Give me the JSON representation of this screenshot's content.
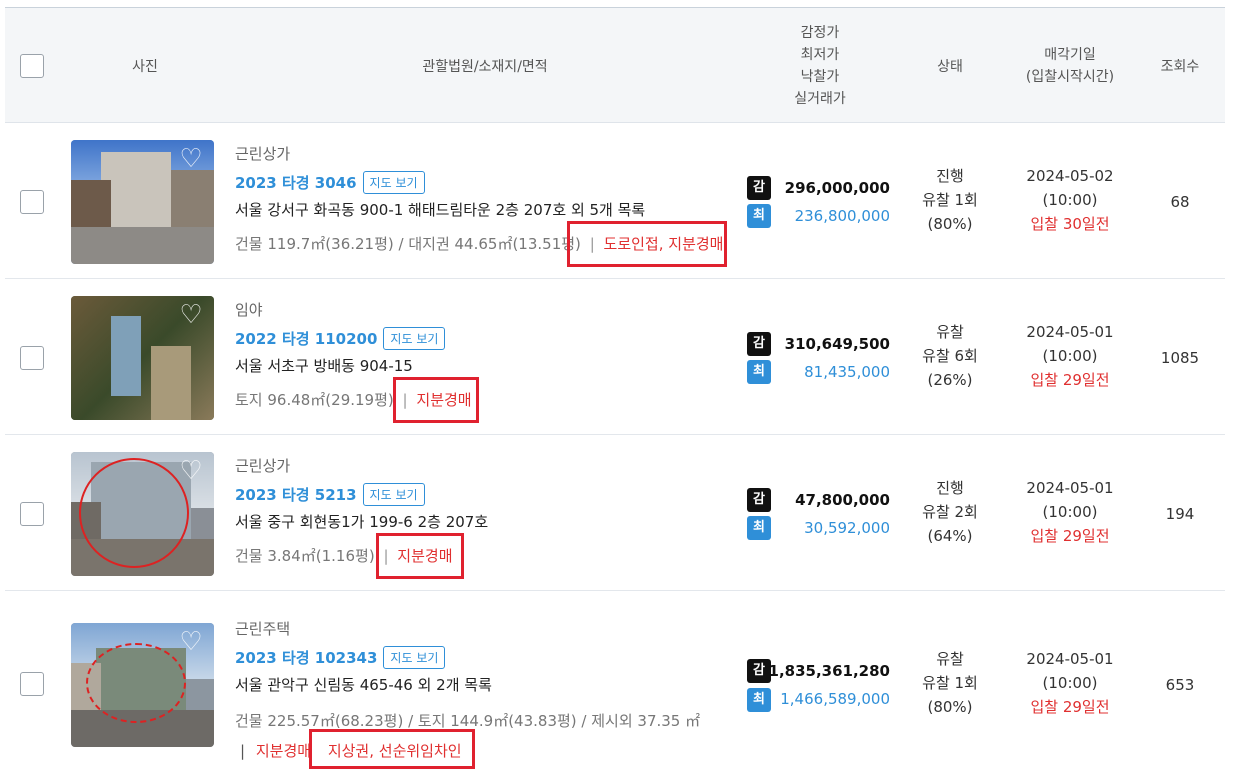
{
  "header": {
    "photo": "사진",
    "info": "관할법원/소재지/면적",
    "price_l1": "감정가",
    "price_l2": "최저가",
    "price_l3": "낙찰가",
    "price_l4": "실거래가",
    "status": "상태",
    "date_l1": "매각기일",
    "date_l2": "(입찰시작시간)",
    "views": "조회수"
  },
  "badges": {
    "appraisal": "감",
    "minimum": "최"
  },
  "map_label": "지도 보기",
  "rows": [
    {
      "type": "근린상가",
      "case_no": "2023 타경 3046",
      "address": "서울 강서구 화곡동 900-1 해태드림타운 2층 207호 외 5개 목록",
      "area": "건물 119.7㎡(36.21평) / 대지권 44.65㎡(13.51평)",
      "sep": "|",
      "tags": "도로인접, 지분경매",
      "appraisal": "296,000,000",
      "minimum": "236,800,000",
      "status1": "진행",
      "status2": "유찰 1회",
      "status3": "(80%)",
      "date": "2024-05-02",
      "time": "(10:00)",
      "dday": "입찰 30일전",
      "views": "68"
    },
    {
      "type": "임야",
      "case_no": "2022 타경 110200",
      "address": "서울 서초구 방배동 904-15",
      "area": "토지 96.48㎡(29.19평)",
      "sep": "|",
      "tags": "지분경매",
      "appraisal": "310,649,500",
      "minimum": "81,435,000",
      "status1": "유찰",
      "status2": "유찰 6회",
      "status3": "(26%)",
      "date": "2024-05-01",
      "time": "(10:00)",
      "dday": "입찰 29일전",
      "views": "1085"
    },
    {
      "type": "근린상가",
      "case_no": "2023 타경 5213",
      "address": "서울 중구 회현동1가 199-6 2층 207호",
      "area": "건물 3.84㎡(1.16평)",
      "sep": "|",
      "tags": "지분경매",
      "appraisal": "47,800,000",
      "minimum": "30,592,000",
      "status1": "진행",
      "status2": "유찰 2회",
      "status3": "(64%)",
      "date": "2024-05-01",
      "time": "(10:00)",
      "dday": "입찰 29일전",
      "views": "194"
    },
    {
      "type": "근린주택",
      "case_no": "2023 타경 102343",
      "address": "서울 관악구 신림동 465-46 외 2개 목록",
      "area": "건물 225.57㎡(68.23평) / 토지 144.9㎡(43.83평) / 제시외 37.35 ㎡",
      "sep": "|",
      "tags_a": "지분경매",
      "tags_b": "지상권, 선순위임차인",
      "appraisal": "1,835,361,280",
      "minimum": "1,466,589,000",
      "status1": "유찰",
      "status2": "유찰 1회",
      "status3": "(80%)",
      "date": "2024-05-01",
      "time": "(10:00)",
      "dday": "입찰 29일전",
      "views": "653"
    }
  ],
  "colors": {
    "accent": "#2f8fd8",
    "danger": "#e03030",
    "highlight_box": "#e0212f"
  }
}
